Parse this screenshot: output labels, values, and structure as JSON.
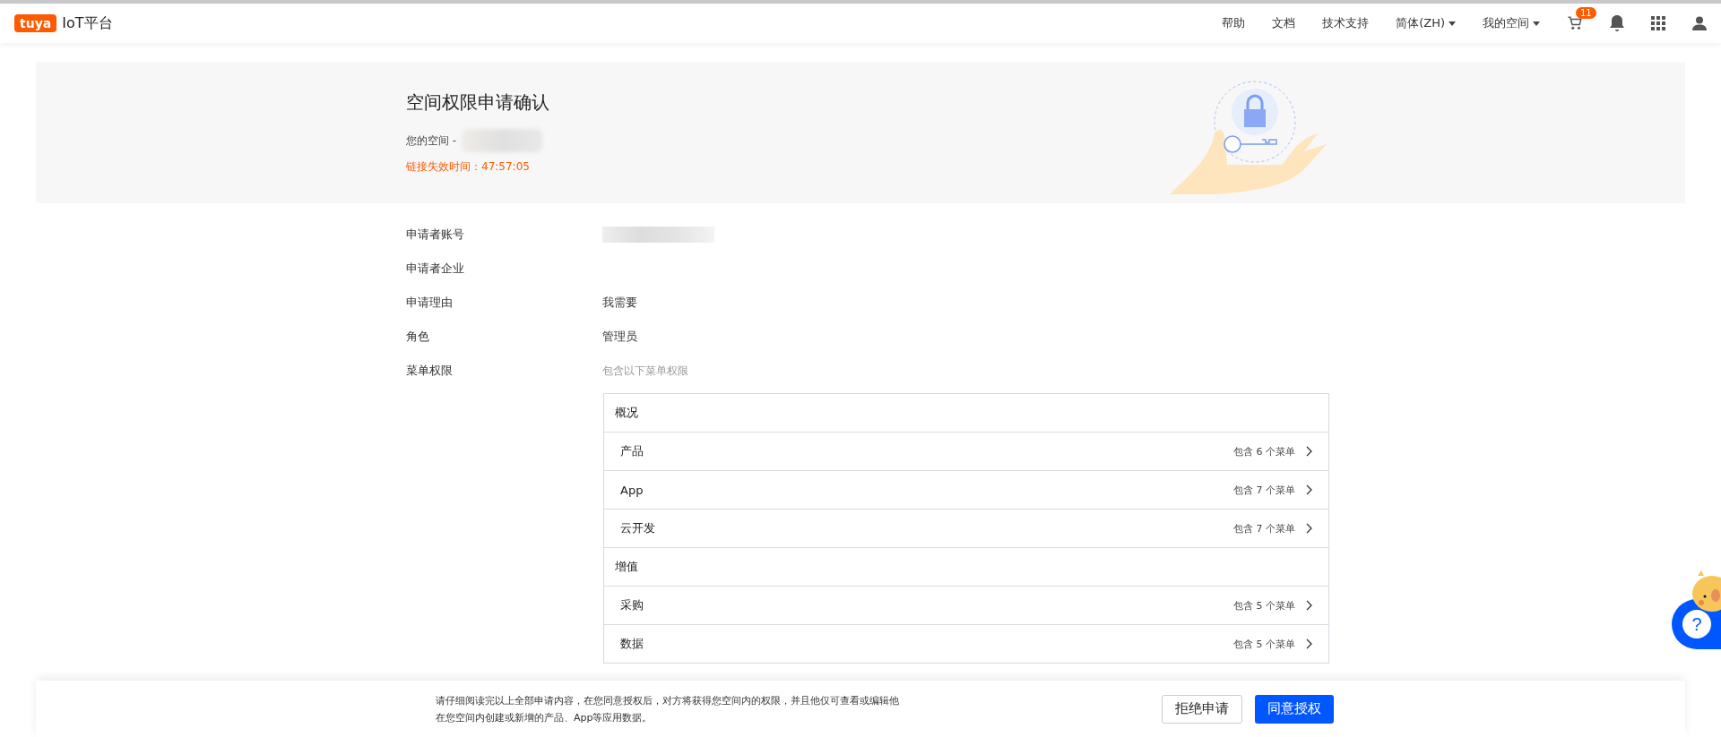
{
  "topbar": {
    "logo_mark": "tuya",
    "logo_text": "IoT平台",
    "links": [
      {
        "label": "帮助",
        "dropdown": false
      },
      {
        "label": "文档",
        "dropdown": false
      },
      {
        "label": "技术支持",
        "dropdown": false
      },
      {
        "label": "简体(ZH)",
        "dropdown": true
      },
      {
        "label": "我的空间",
        "dropdown": true
      }
    ],
    "cart_badge": "11"
  },
  "banner": {
    "title": "空间权限申请确认",
    "space_label": "您的空间 -",
    "expiry": "链接失效时间：47:57:05"
  },
  "fields": [
    {
      "label": "申请者账号",
      "kind": "redacted"
    },
    {
      "label": "申请者企业",
      "kind": "text"
    },
    {
      "label": "申请理由",
      "value": "我需要",
      "kind": "text"
    },
    {
      "label": "角色",
      "value": "管理员",
      "kind": "text"
    },
    {
      "label": "菜单权限",
      "value": "包含以下菜单权限",
      "kind": "hint"
    }
  ],
  "menus": [
    {
      "name": "概况",
      "kind": "group"
    },
    {
      "name": "产品",
      "kind": "item",
      "count": "包含 6 个菜单"
    },
    {
      "name": "App",
      "kind": "item",
      "count": "包含 7 个菜单"
    },
    {
      "name": "云开发",
      "kind": "item",
      "count": "包含 7 个菜单"
    },
    {
      "name": "增值",
      "kind": "group"
    },
    {
      "name": "采购",
      "kind": "item",
      "count": "包含 5 个菜单"
    },
    {
      "name": "数据",
      "kind": "item",
      "count": "包含 5 个菜单"
    }
  ],
  "footer": {
    "notice_lines": [
      "请仔细阅读完以上全部申请内容，在您同意授权后，对方将获得您空间内的权限，并且他仅可查看或编辑他",
      "在您空间内创建或新增的产品、App等应用数据。"
    ],
    "reject_button": "拒绝申请",
    "accept_button": "同意授权"
  },
  "help_button": "?"
}
